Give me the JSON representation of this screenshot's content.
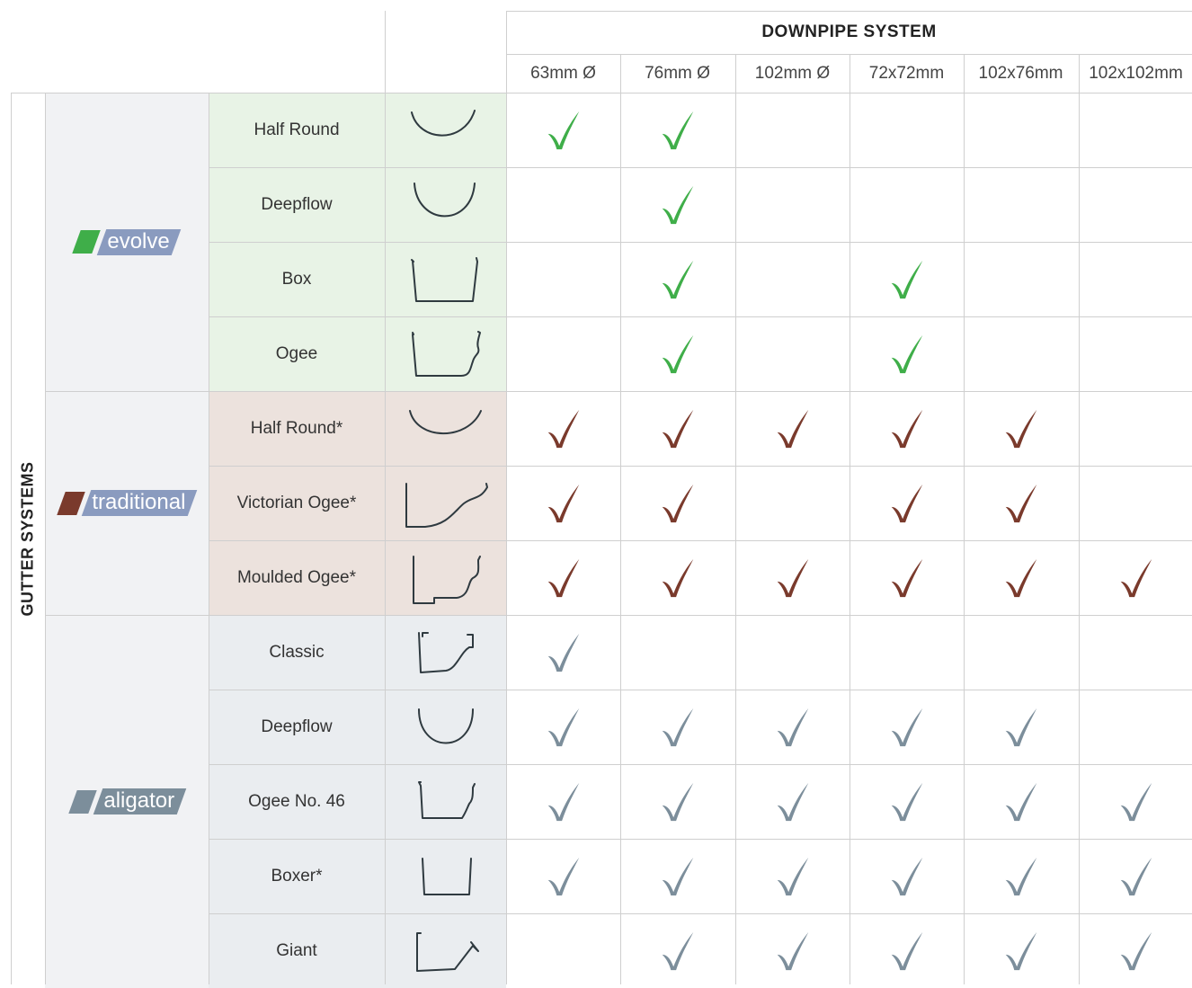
{
  "header": {
    "title": "DOWNPIPE SYSTEM",
    "side_label": "GUTTER SYSTEMS",
    "columns": [
      "63mm Ø",
      "76mm Ø",
      "102mm Ø",
      "72x72mm",
      "102x76mm",
      "102x102mm"
    ]
  },
  "colors": {
    "evolve_green": "#3fae49",
    "evolve_bg": "#e8f3e6",
    "traditional_brown": "#7a3a2c",
    "traditional_bg": "#ece2dd",
    "aligator_grey": "#7c8e9b",
    "aligator_bg": "#eaedf0",
    "brand_bg": "#f1f2f4",
    "logo_blue": "#8a9bbf"
  },
  "groups": [
    {
      "brand": "evolve",
      "color_key": "evolve",
      "rows": [
        {
          "name": "Half Round",
          "profile": "half-round-profile-icon",
          "checks": [
            1,
            1,
            0,
            0,
            0,
            0
          ]
        },
        {
          "name": "Deepflow",
          "profile": "deepflow-profile-icon",
          "checks": [
            0,
            1,
            0,
            0,
            0,
            0
          ]
        },
        {
          "name": "Box",
          "profile": "box-profile-icon",
          "checks": [
            0,
            1,
            0,
            1,
            0,
            0
          ]
        },
        {
          "name": "Ogee",
          "profile": "ogee-profile-icon",
          "checks": [
            0,
            1,
            0,
            1,
            0,
            0
          ]
        }
      ]
    },
    {
      "brand": "traditional",
      "color_key": "traditional",
      "rows": [
        {
          "name": "Half Round*",
          "profile": "half-round-shallow-profile-icon",
          "checks": [
            1,
            1,
            1,
            1,
            1,
            0
          ]
        },
        {
          "name": "Victorian Ogee*",
          "profile": "victorian-ogee-profile-icon",
          "checks": [
            1,
            1,
            0,
            1,
            1,
            0
          ]
        },
        {
          "name": "Moulded Ogee*",
          "profile": "moulded-ogee-profile-icon",
          "checks": [
            1,
            1,
            1,
            1,
            1,
            1
          ]
        }
      ]
    },
    {
      "brand": "aligator",
      "color_key": "aligator",
      "rows": [
        {
          "name": "Classic",
          "profile": "classic-profile-icon",
          "checks": [
            1,
            0,
            0,
            0,
            0,
            0
          ]
        },
        {
          "name": "Deepflow",
          "profile": "deepflow-small-profile-icon",
          "checks": [
            1,
            1,
            1,
            1,
            1,
            0
          ]
        },
        {
          "name": "Ogee No. 46",
          "profile": "ogee-46-profile-icon",
          "checks": [
            1,
            1,
            1,
            1,
            1,
            1
          ]
        },
        {
          "name": "Boxer*",
          "profile": "boxer-profile-icon",
          "checks": [
            1,
            1,
            1,
            1,
            1,
            1
          ]
        },
        {
          "name": "Giant",
          "profile": "giant-profile-icon",
          "checks": [
            0,
            1,
            1,
            1,
            1,
            1
          ]
        }
      ]
    }
  ]
}
